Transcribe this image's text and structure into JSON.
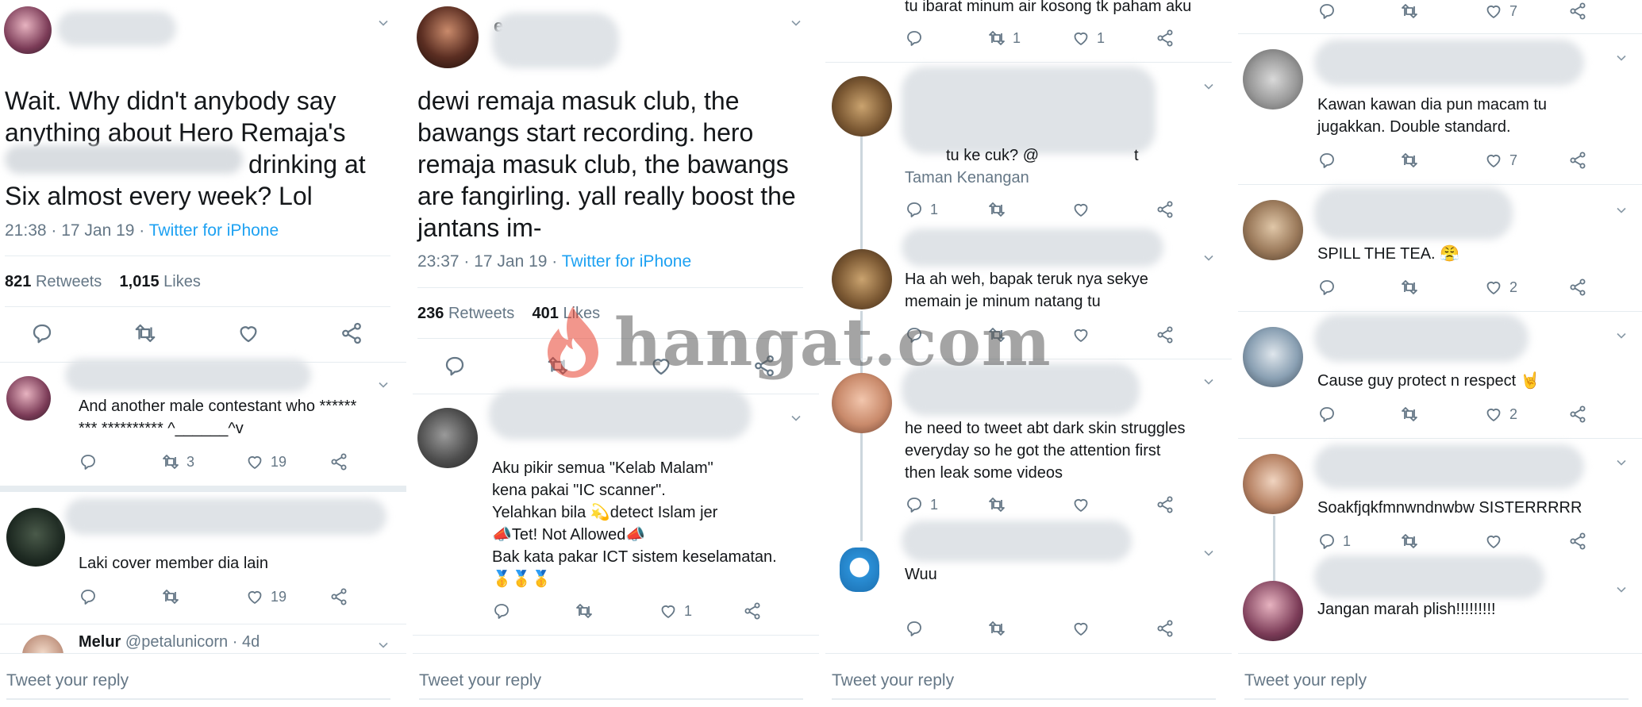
{
  "panel1": {
    "tweet_text": [
      "Wait. Why didn't anybody say",
      "anything about Hero Remaja's",
      "drinking at",
      "Six almost every week? Lol"
    ],
    "time": "21:38 · 17 Jan 19 · ",
    "source": "Twitter for iPhone",
    "retweets": "821",
    "retweets_label": "Retweets",
    "likes": "1,015",
    "likes_label": "Likes",
    "replies": [
      {
        "text": [
          "And another male contestant who ******",
          "*** ********** ^______^v"
        ],
        "retweets": "3",
        "likes": "19"
      },
      {
        "text": [
          "Laki cover member dia lain"
        ],
        "retweets": "",
        "likes": "19"
      },
      {
        "name": "Melur",
        "handle": "@petalunicorn · 4d"
      }
    ]
  },
  "panel2": {
    "author_initial": "e",
    "tweet_text": [
      "dewi remaja masuk club, the",
      "bawangs start recording. hero",
      "remaja masuk club, the bawangs",
      "are fangirling. yall really boost the",
      "jantans im-"
    ],
    "time": "23:37 · 17 Jan 19 · ",
    "source": "Twitter for iPhone",
    "retweets": "236",
    "retweets_label": "Retweets",
    "likes": "401",
    "likes_label": "Likes",
    "reply": {
      "text": [
        "Aku pikir semua \"Kelab Malam\"",
        "kena pakai \"IC scanner\".",
        "Yelahkan bila 💫detect Islam jer",
        "📣Tet! Not Allowed📣",
        "Bak kata pakar ICT sistem keselamatan.",
        "🥇🥇🥇"
      ],
      "likes": "1"
    }
  },
  "panel3": {
    "top_text": "tu ibarat minum air kosong tk paham aku",
    "top_retweets": "1",
    "top_likes": "1",
    "replies": [
      {
        "text": [
          "tu ke cuk? @",
          "t"
        ],
        "location": "Taman Kenangan",
        "replies": "1"
      },
      {
        "text": [
          "Ha ah weh, bapak teruk nya sekye",
          "memain je minum natang tu"
        ]
      },
      {
        "text": [
          "he need to tweet abt dark skin struggles",
          "everyday so he got the attention first",
          "then leak some videos"
        ],
        "replies": "1"
      },
      {
        "text": [
          "Wuu"
        ]
      }
    ]
  },
  "panel4": {
    "top_likes": "7",
    "replies": [
      {
        "text": [
          "Kawan kawan dia pun macam tu",
          "jugakkan. Double standard."
        ],
        "likes": "7"
      },
      {
        "text": [
          "SPILL THE TEA. 😤"
        ],
        "likes": "2"
      },
      {
        "text": [
          "Cause guy protect n respect 🤘"
        ],
        "likes": "2"
      },
      {
        "text": [
          "Soakfjqkfmnwndnwbw SISTERRRRR"
        ],
        "replies": "1"
      },
      {
        "text": [
          "Jangan marah plish!!!!!!!!!"
        ]
      }
    ]
  },
  "footer": {
    "placeholder": "Tweet your reply"
  },
  "watermark": {
    "text": "hangat.com"
  },
  "colors": {
    "link": "#1da1f2",
    "muted": "#657786",
    "divider": "#e6ecf0",
    "text": "#14171a"
  }
}
